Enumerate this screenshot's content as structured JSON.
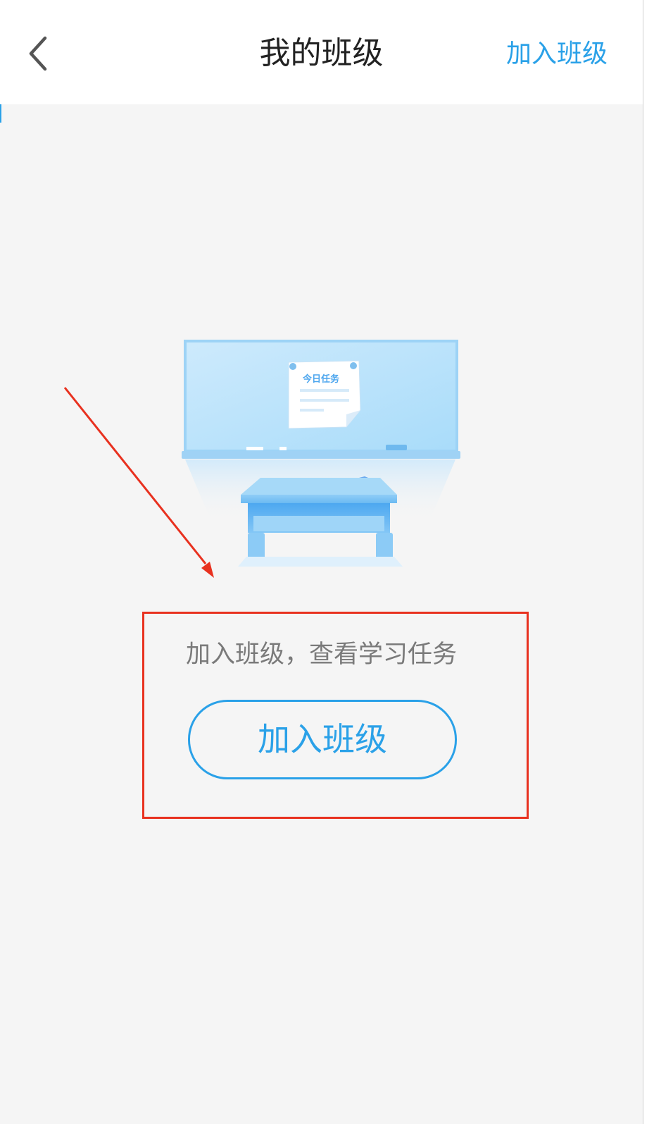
{
  "header": {
    "title": "我的班级",
    "action_label": "加入班级",
    "back_icon": "chevron-left-icon"
  },
  "illustration": {
    "note_text": "今日任务"
  },
  "empty_state": {
    "message": "加入班级，查看学习任务",
    "button_label": "加入班级"
  },
  "colors": {
    "accent": "#2aa1e8",
    "annotation": "#e8311f",
    "background": "#f5f5f5",
    "nav_background": "#ffffff"
  }
}
